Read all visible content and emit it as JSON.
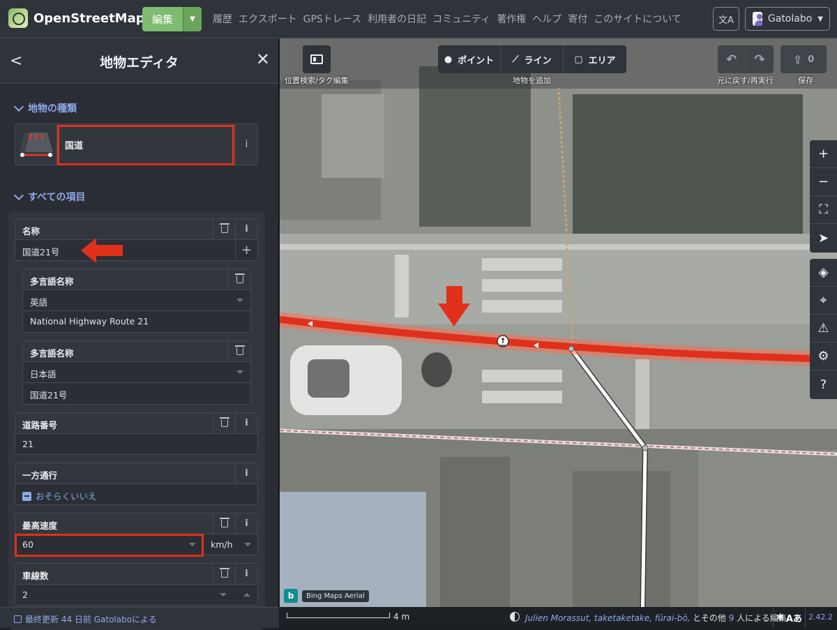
{
  "topbar": {
    "app_name": "OpenStreetMap",
    "edit_label": "編集",
    "nav_items": [
      "履歴",
      "エクスポート",
      "GPSトレース",
      "利用者の日記",
      "コミュニティ",
      "著作権",
      "ヘルプ",
      "寄付",
      "このサイトについて"
    ],
    "user_name": "Gatolabo",
    "lang_glyph": "文A"
  },
  "sidebar": {
    "title": "地物エディタ",
    "feature_type_section": "地物の種類",
    "preset_name": "国道",
    "all_fields_section": "すべての項目",
    "fields": {
      "name_label": "名称",
      "name_value": "国道21号",
      "multilingual_label": "多言語名称",
      "ml1_lang": "英語",
      "ml1_value": "National Highway Route 21",
      "ml2_lang": "日本語",
      "ml2_value": "国道21号",
      "ref_label": "道路番号",
      "ref_value": "21",
      "oneway_label": "一方通行",
      "oneway_value": "おそらくいいえ",
      "maxspeed_label": "最高速度",
      "maxspeed_value": "60",
      "maxspeed_unit": "km/h",
      "lanes_label": "車線数",
      "lanes_value": "2"
    },
    "footer": "最終更新 44 日前 Gatolaboによる"
  },
  "map": {
    "toolbar": {
      "search_label": "位置検索/タグ編集",
      "point": "ポイント",
      "line": "ライン",
      "area": "エリア",
      "add_feature_label": "地物を追加",
      "undo_redo_label": "元に戻す/再実行",
      "save_label": "保存",
      "save_count": "0"
    },
    "imagery": "Bing Maps Aerial",
    "scale": "4 m",
    "credits_users": "Julien Morassut, taketaketake, fūrai-bō,",
    "credits_rest_1": " とその他 ",
    "credits_count": "9",
    "credits_rest_2": " 人による編集",
    "issue_glyph": "Aあ",
    "version": "2.42.2"
  },
  "colors": {
    "accent": "#7ebc6f",
    "link": "#8fa8e8",
    "highlight": "#e0301c",
    "selected_way": "#e0301c"
  }
}
